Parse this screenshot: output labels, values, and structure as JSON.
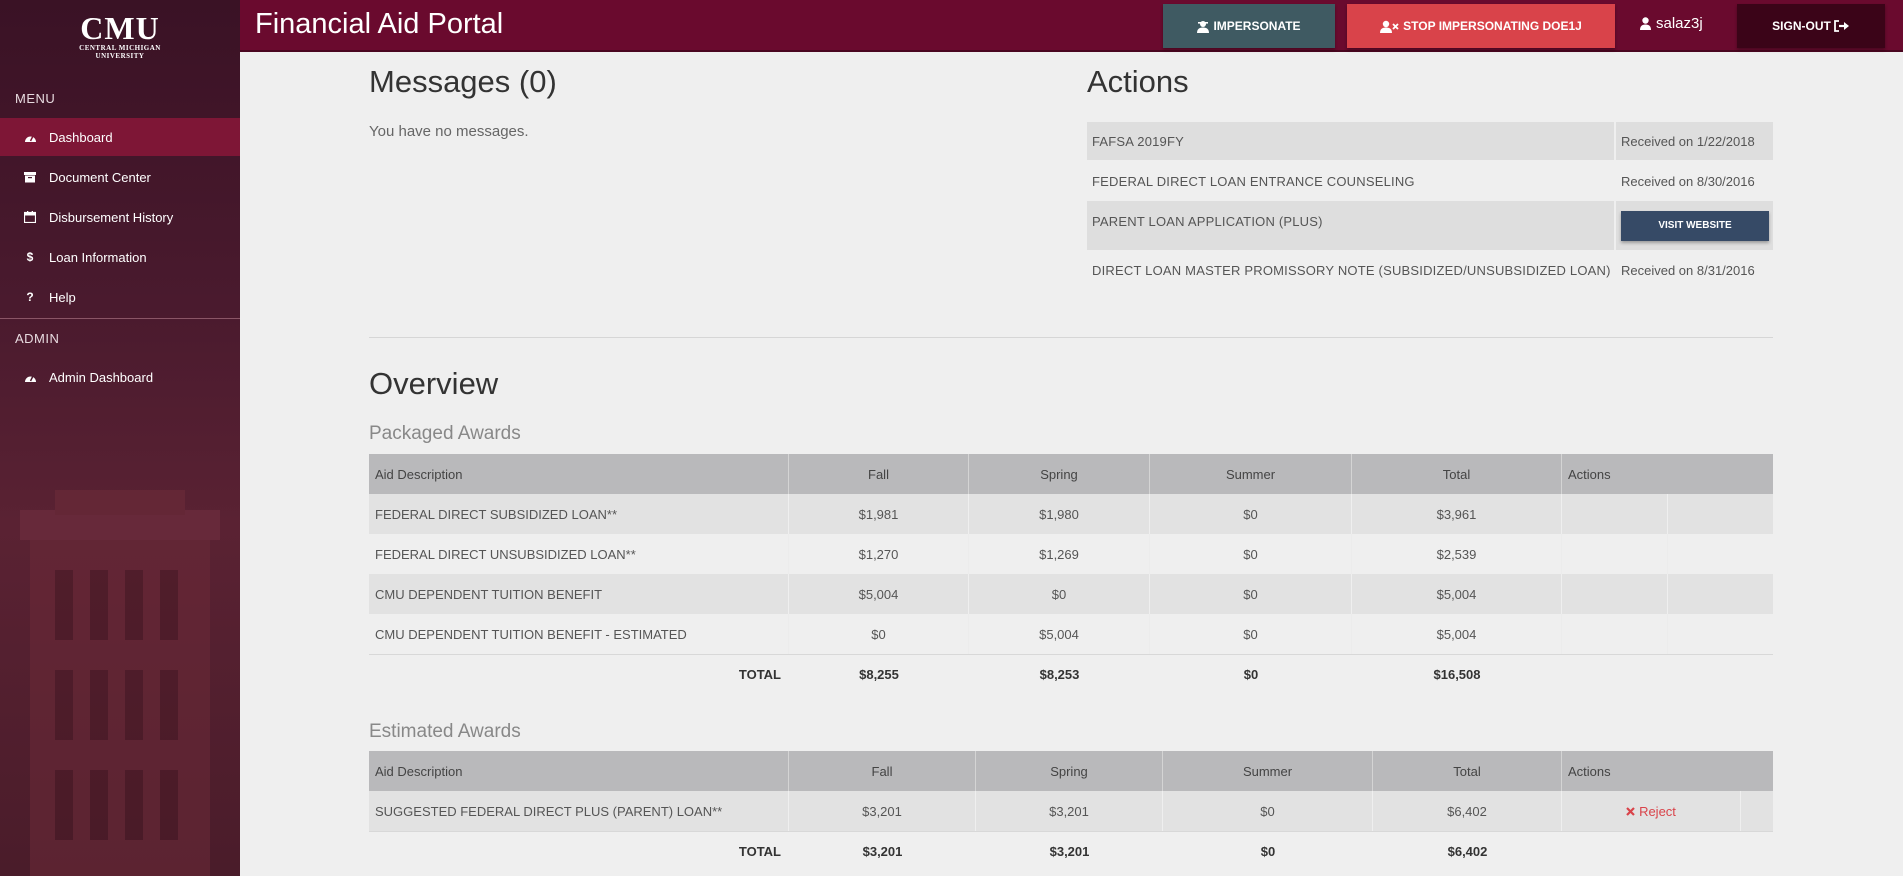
{
  "app": {
    "title": "Financial Aid Portal"
  },
  "logo": {
    "wordmark": "CMU",
    "line1": "CENTRAL MICHIGAN",
    "line2": "UNIVERSITY"
  },
  "sidebar": {
    "menu_heading": "MENU",
    "items": [
      {
        "label": "Dashboard",
        "icon": "dashboard-icon",
        "active": true
      },
      {
        "label": "Document Center",
        "icon": "archive-icon"
      },
      {
        "label": "Disbursement History",
        "icon": "calendar-icon"
      },
      {
        "label": "Loan Information",
        "icon": "dollar-icon"
      },
      {
        "label": "Help",
        "icon": "question-icon"
      }
    ],
    "admin_heading": "ADMIN",
    "admin_items": [
      {
        "label": "Admin Dashboard",
        "icon": "dashboard-icon"
      }
    ]
  },
  "header": {
    "impersonate_label": "IMPERSONATE",
    "stop_label": "STOP IMPERSONATING DOE1J",
    "username": "salaz3j",
    "signout_label": "SIGN-OUT"
  },
  "messages": {
    "title": "Messages (0)",
    "empty_text": "You have no messages."
  },
  "actions": {
    "title": "Actions",
    "rows": [
      {
        "description": "FAFSA 2019FY",
        "status": "Received on 1/22/2018"
      },
      {
        "description": "FEDERAL DIRECT LOAN ENTRANCE COUNSELING",
        "status": "Received on 8/30/2016"
      },
      {
        "description": "PARENT LOAN APPLICATION (PLUS)",
        "button": "VISIT WEBSITE"
      },
      {
        "description": "DIRECT LOAN MASTER PROMISSORY NOTE (SUBSIDIZED/UNSUBSIDIZED LOAN)",
        "status": "Received on 8/31/2016"
      }
    ]
  },
  "overview": {
    "title": "Overview",
    "packaged": {
      "title": "Packaged Awards",
      "headers": [
        "Aid Description",
        "Fall",
        "Spring",
        "Summer",
        "Total",
        "Actions"
      ],
      "rows": [
        [
          "FEDERAL DIRECT SUBSIDIZED LOAN**",
          "$1,981",
          "$1,980",
          "$0",
          "$3,961"
        ],
        [
          "FEDERAL DIRECT UNSUBSIDIZED LOAN**",
          "$1,270",
          "$1,269",
          "$0",
          "$2,539"
        ],
        [
          "CMU DEPENDENT TUITION BENEFIT",
          "$5,004",
          "$0",
          "$0",
          "$5,004"
        ],
        [
          "CMU DEPENDENT TUITION BENEFIT - ESTIMATED",
          "$0",
          "$5,004",
          "$0",
          "$5,004"
        ]
      ],
      "total": [
        "TOTAL",
        "$8,255",
        "$8,253",
        "$0",
        "$16,508"
      ]
    },
    "estimated": {
      "title": "Estimated Awards",
      "headers": [
        "Aid Description",
        "Fall",
        "Spring",
        "Summer",
        "Total",
        "Actions"
      ],
      "rows": [
        [
          "SUGGESTED FEDERAL DIRECT PLUS (PARENT) LOAN**",
          "$3,201",
          "$3,201",
          "$0",
          "$6,402"
        ]
      ],
      "reject_label": "Reject",
      "total": [
        "TOTAL",
        "$3,201",
        "$3,201",
        "$0",
        "$6,402"
      ]
    }
  },
  "colors": {
    "header_bg": "#6a0a2e",
    "active_nav": "#7e1636",
    "impersonate_btn": "#3f5a62",
    "stop_btn": "#d9434a",
    "signout_btn": "#3b0418",
    "visit_btn": "#364a66",
    "reject_text": "#d9434a"
  }
}
